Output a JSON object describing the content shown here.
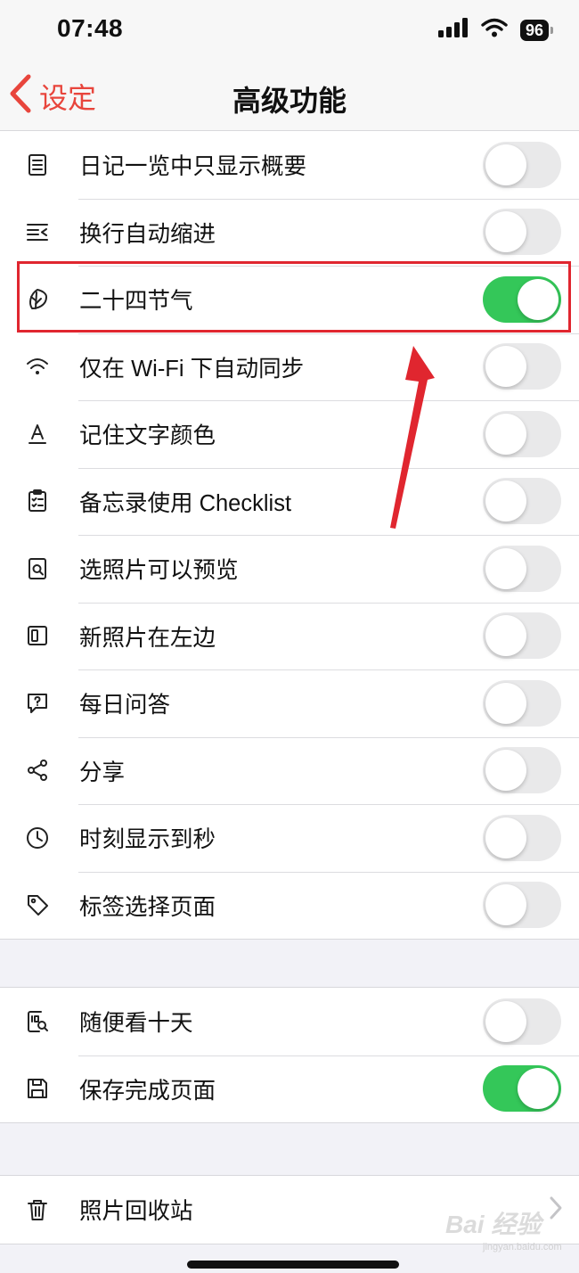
{
  "status_bar": {
    "time": "07:48",
    "battery": "96"
  },
  "nav": {
    "back_label": "设定",
    "title": "高级功能"
  },
  "group1": [
    {
      "label": "日记一览中只显示概要",
      "icon": "list-document-icon",
      "on": false
    },
    {
      "label": "换行自动缩进",
      "icon": "indent-icon",
      "on": false
    },
    {
      "label": "二十四节气",
      "icon": "leaf-icon",
      "on": true
    },
    {
      "label": "仅在 Wi-Fi 下自动同步",
      "icon": "wifi-icon",
      "on": false
    },
    {
      "label": "记住文字颜色",
      "icon": "text-color-icon",
      "on": false
    },
    {
      "label": "备忘录使用 Checklist",
      "icon": "checklist-icon",
      "on": false
    },
    {
      "label": "选照片可以预览",
      "icon": "photo-preview-icon",
      "on": false
    },
    {
      "label": "新照片在左边",
      "icon": "photo-left-icon",
      "on": false
    },
    {
      "label": "每日问答",
      "icon": "question-bubble-icon",
      "on": false
    },
    {
      "label": "分享",
      "icon": "share-icon",
      "on": false
    },
    {
      "label": "时刻显示到秒",
      "icon": "clock-icon",
      "on": false
    },
    {
      "label": "标签选择页面",
      "icon": "tag-icon",
      "on": false
    }
  ],
  "group2": [
    {
      "label": "随便看十天",
      "icon": "ten-days-icon",
      "on": false
    },
    {
      "label": "保存完成页面",
      "icon": "save-icon",
      "on": true
    }
  ],
  "group3": [
    {
      "label": "照片回收站",
      "icon": "trash-icon"
    }
  ],
  "watermark": {
    "text": "Bai 经验",
    "sub": "jingyan.baidu.com"
  },
  "colors": {
    "accent_red": "#e8453c",
    "toggle_on": "#34c759",
    "toggle_off": "#e9e9ea",
    "highlight": "#e0262f"
  }
}
